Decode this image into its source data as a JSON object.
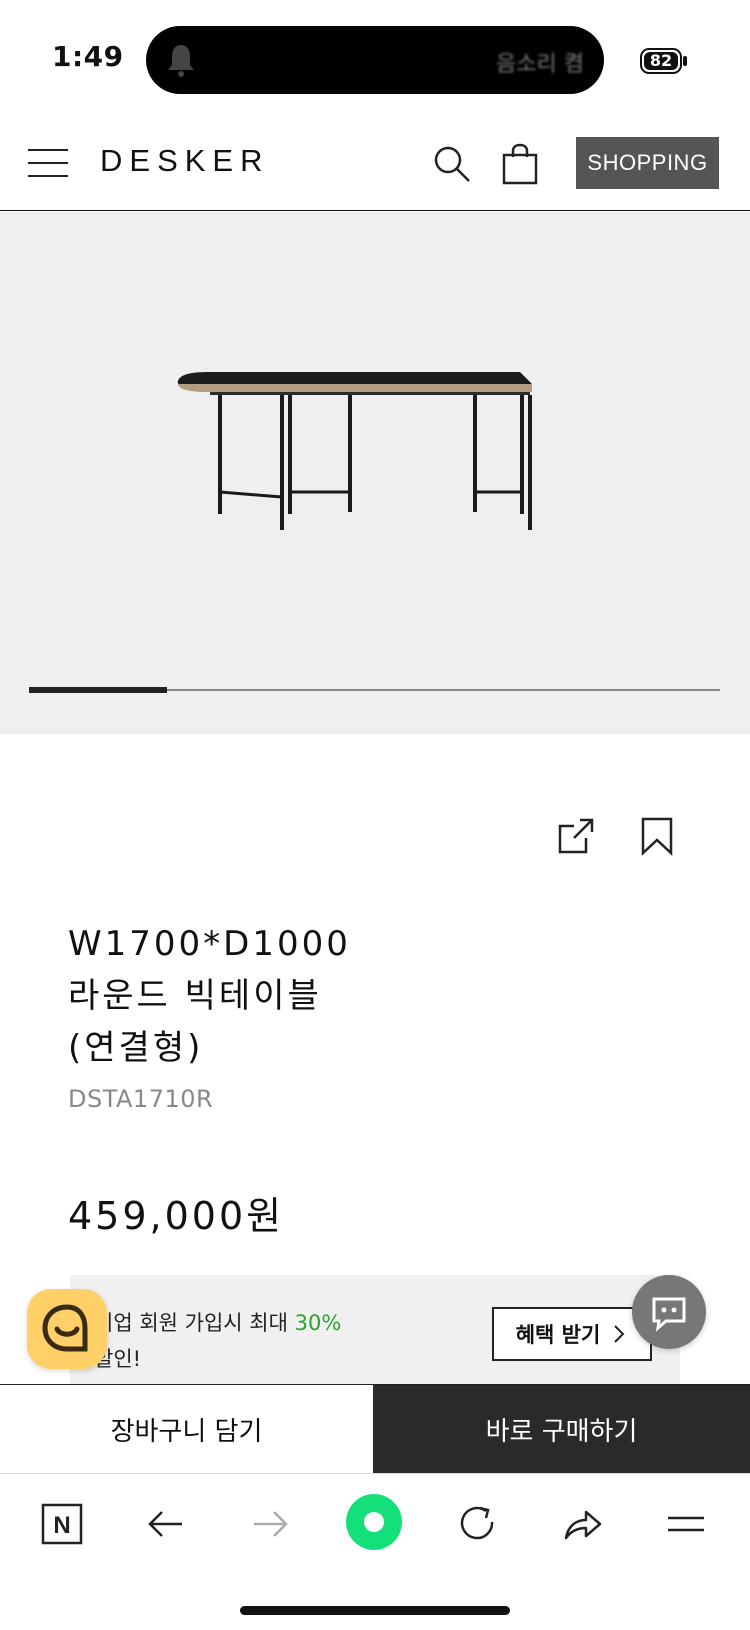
{
  "status_bar": {
    "time": "1:49",
    "island_text": "음소리 켬",
    "battery": "82"
  },
  "header": {
    "logo": "DESKER",
    "shopping_label": "SHOPPING"
  },
  "gallery": {
    "progress": 0.2
  },
  "product": {
    "title_line1": "W1700*D1000",
    "title_line2": "라운드 빅테이블",
    "title_line3": "(연결형)",
    "code": "DSTA1710R",
    "price": "459,000원"
  },
  "promo": {
    "line1_prefix": "기업 회원 가입시 최대 ",
    "line1_percent": "30%",
    "line2": "할인!",
    "benefit_button": "혜택 받기"
  },
  "actions": {
    "cart": "장바구니 담기",
    "buy": "바로 구매하기"
  },
  "browser_toolbar": {
    "naver_label": "N"
  },
  "colors": {
    "accent_green": "#2aa52a",
    "buy_button": "#2a2a2a",
    "chat_yellow": "#ffcf68",
    "naver_green": "#14e07a"
  }
}
